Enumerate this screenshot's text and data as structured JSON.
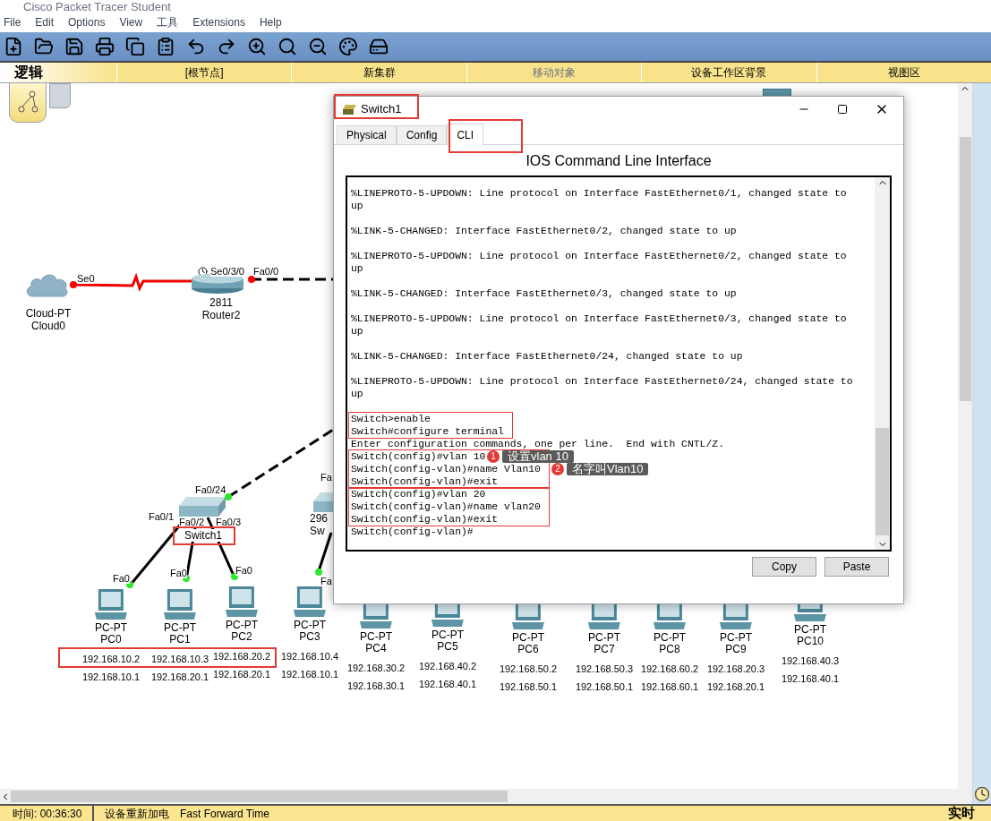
{
  "app": {
    "title": "Cisco Packet Tracer Student"
  },
  "menu": [
    "File",
    "Edit",
    "Options",
    "View",
    "工具",
    "Extensions",
    "Help"
  ],
  "workspace_bar": {
    "mode": "逻辑",
    "items": [
      {
        "label": "[根节点]",
        "disabled": false
      },
      {
        "label": "新集群",
        "disabled": false
      },
      {
        "label": "移动对象",
        "disabled": true
      },
      {
        "label": "设备工作区背景",
        "disabled": false
      },
      {
        "label": "视图区",
        "disabled": false
      }
    ]
  },
  "canvas": {
    "devices": [
      {
        "kind": "cloud",
        "labels": [
          "Cloud-PT",
          "Cloud0"
        ]
      },
      {
        "kind": "router",
        "labels": [
          "2811",
          "Router2"
        ]
      },
      {
        "kind": "switch",
        "labels": [
          "Switch1"
        ]
      },
      {
        "kind": "switch",
        "labels": [
          "296",
          "Sw"
        ]
      }
    ],
    "port_labels": [
      "Se0",
      "Se0/3/0",
      "Fa0/0",
      "Fa0/24",
      "Fa0/1",
      "Fa0/2",
      "Fa0/3",
      "Fa0",
      "Fa0",
      "Fa0",
      "Fa",
      "Fa"
    ],
    "pcs": [
      {
        "model": "PC-PT",
        "name": "PC0",
        "ip": "192.168.10.2",
        "gateway": "192.168.10.1"
      },
      {
        "model": "PC-PT",
        "name": "PC1",
        "ip": "192.168.10.3",
        "gateway": "192.168.20.1"
      },
      {
        "model": "PC-PT",
        "name": "PC2",
        "ip": "192.168.20.2",
        "gateway": "192.168.20.1"
      },
      {
        "model": "PC-PT",
        "name": "PC3",
        "ip": "192.168.10.4",
        "gateway": "192.168.10.1"
      },
      {
        "model": "PC-PT",
        "name": "PC4",
        "ip": "192.168.30.2",
        "gateway": "192.168.30.1"
      },
      {
        "model": "PC-PT",
        "name": "PC5",
        "ip": "192.168.40.2",
        "gateway": "192.168.40.1"
      },
      {
        "model": "PC-PT",
        "name": "PC6",
        "ip": "192.168.50.2",
        "gateway": "192.168.50.1"
      },
      {
        "model": "PC-PT",
        "name": "PC7",
        "ip": "192.168.50.3",
        "gateway": "192.168.50.1"
      },
      {
        "model": "PC-PT",
        "name": "PC8",
        "ip": "192.168.60.2",
        "gateway": "192.168.60.1"
      },
      {
        "model": "PC-PT",
        "name": "PC9",
        "ip": "192.168.20.3",
        "gateway": "192.168.20.1"
      },
      {
        "model": "PC-PT",
        "name": "PC10",
        "ip": "192.168.40.3",
        "gateway": "192.168.40.1"
      }
    ]
  },
  "dialog": {
    "title": "Switch1",
    "tabs": [
      {
        "label": "Physical",
        "selected": false
      },
      {
        "label": "Config",
        "selected": false
      },
      {
        "label": "CLI",
        "selected": true
      }
    ],
    "heading": "IOS Command Line Interface",
    "cli_blocks": [
      {
        "kind": "message",
        "highlighted": false,
        "lines": [
          "%LINEPROTO-5-UPDOWN: Line protocol on Interface FastEthernet0/1, changed state to up"
        ]
      },
      {
        "kind": "message",
        "highlighted": false,
        "lines": [
          "%LINK-5-CHANGED: Interface FastEthernet0/2, changed state to up"
        ]
      },
      {
        "kind": "message",
        "highlighted": false,
        "lines": [
          "%LINEPROTO-5-UPDOWN: Line protocol on Interface FastEthernet0/2, changed state to up"
        ]
      },
      {
        "kind": "message",
        "highlighted": false,
        "lines": [
          "%LINK-5-CHANGED: Interface FastEthernet0/3, changed state to up"
        ]
      },
      {
        "kind": "message",
        "highlighted": false,
        "lines": [
          "%LINEPROTO-5-UPDOWN: Line protocol on Interface FastEthernet0/3, changed state to up"
        ]
      },
      {
        "kind": "message",
        "highlighted": false,
        "lines": [
          "%LINK-5-CHANGED: Interface FastEthernet0/24, changed state to up"
        ]
      },
      {
        "kind": "message",
        "highlighted": false,
        "lines": [
          "%LINEPROTO-5-UPDOWN: Line protocol on Interface FastEthernet0/24, changed state to up"
        ]
      },
      {
        "kind": "session",
        "highlighted": true,
        "lines": [
          "Switch>enable",
          "Switch#configure terminal"
        ]
      },
      {
        "kind": "session",
        "highlighted": false,
        "lines": [
          "Enter configuration commands, one per line.  End with CNTL/Z."
        ]
      },
      {
        "kind": "session",
        "highlighted": true,
        "lines": [
          "Switch(config)#vlan 10",
          "Switch(config-vlan)#name Vlan10",
          "Switch(config-vlan)#exit"
        ]
      },
      {
        "kind": "session",
        "highlighted": true,
        "lines": [
          "Switch(config)#vlan 20",
          "Switch(config-vlan)#name vlan20",
          "Switch(config-vlan)#exit"
        ]
      },
      {
        "kind": "session",
        "highlighted": false,
        "lines": [
          "Switch(config-vlan)#"
        ]
      }
    ],
    "callouts": [
      {
        "number": "1",
        "text": "设置vlan 10"
      },
      {
        "number": "2",
        "text": "名字叫Vlan10"
      }
    ],
    "buttons": [
      "Copy",
      "Paste"
    ]
  },
  "status_bar": {
    "time": "时间: 00:36:30",
    "items": [
      "设备重新加电",
      "Fast Forward Time"
    ],
    "mode": "实时"
  }
}
